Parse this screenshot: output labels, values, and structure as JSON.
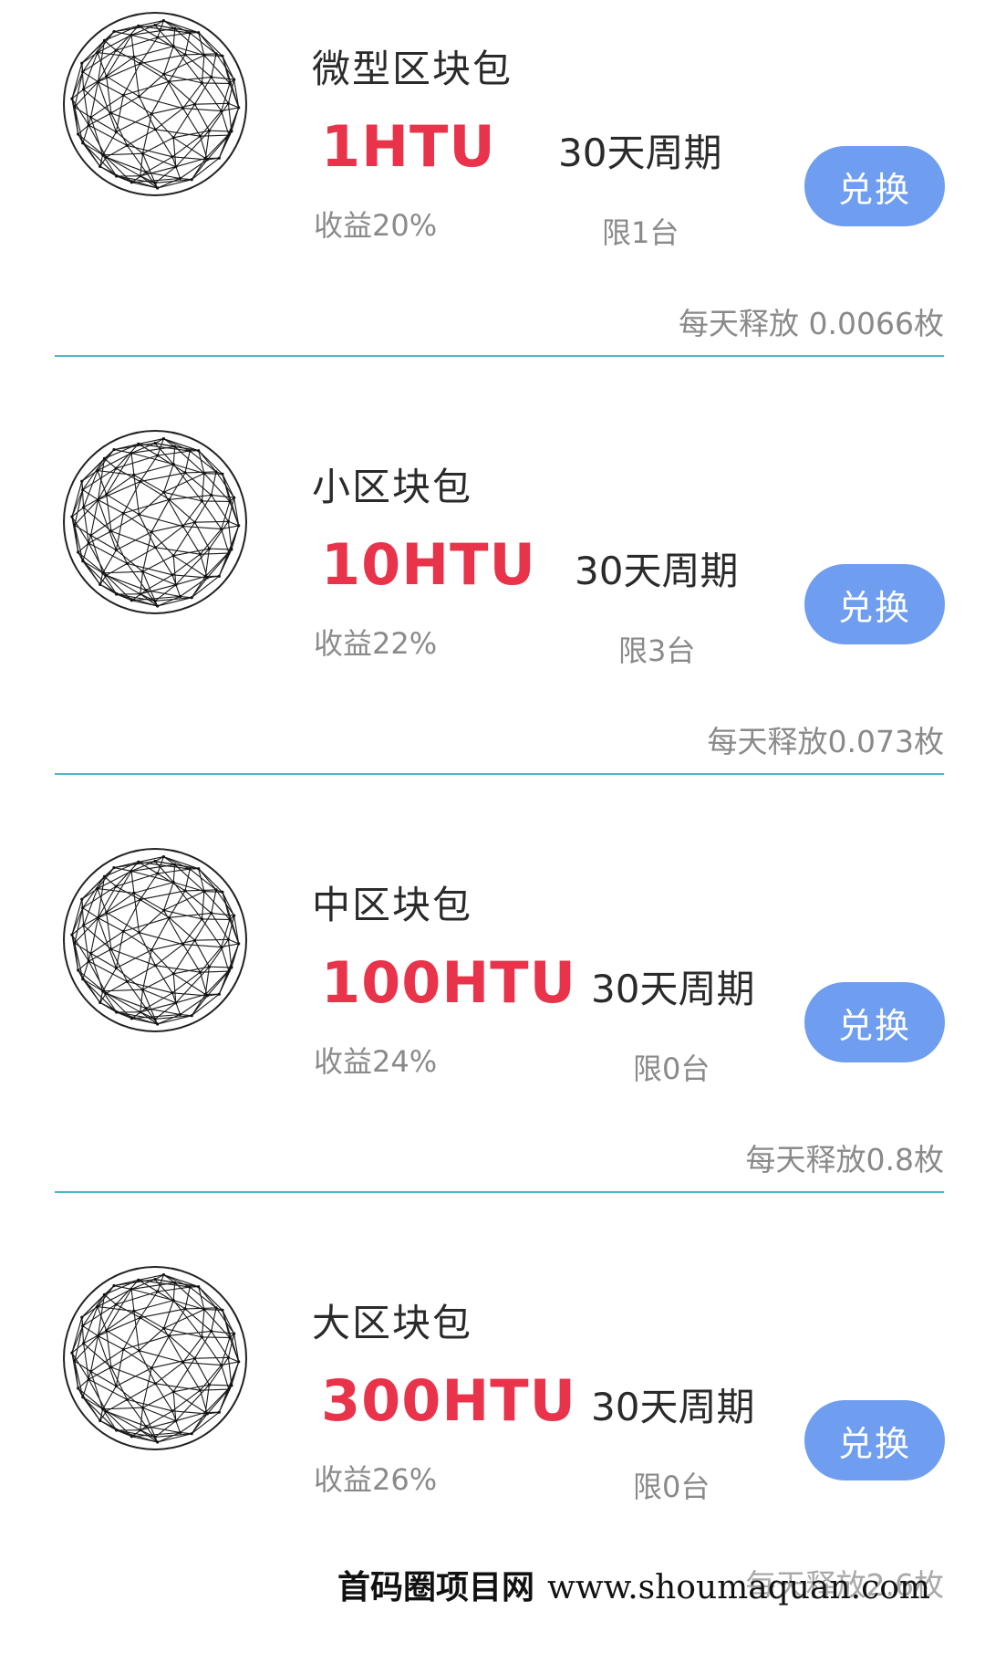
{
  "packages": [
    {
      "name": "微型区块包",
      "price": "1HTU",
      "cycle": "30天周期",
      "yield": "收益20%",
      "limit": "限1台",
      "button": "兑换",
      "release": "每天释放 0.0066枚"
    },
    {
      "name": "小区块包",
      "price": "10HTU",
      "cycle": "30天周期",
      "yield": "收益22%",
      "limit": "限3台",
      "button": "兑换",
      "release": "每天释放0.073枚"
    },
    {
      "name": "中区块包",
      "price": "100HTU",
      "cycle": "30天周期",
      "yield": "收益24%",
      "limit": "限0台",
      "button": "兑换",
      "release": "每天释放0.8枚"
    },
    {
      "name": "大区块包",
      "price": "300HTU",
      "cycle": "30天周期",
      "yield": "收益26%",
      "limit": "限0台",
      "button": "兑换",
      "release": "每天释放2.6枚"
    }
  ],
  "watermark": {
    "brand": "首码圈项目网",
    "site": "www.shoumaquan.com"
  },
  "colors": {
    "price": "#e8334a",
    "button": "#6f9ef0",
    "divider": "#4fb6c8",
    "muted": "#8a8a8a"
  },
  "icons": {
    "package_image": "wireframe-globe-icon"
  }
}
